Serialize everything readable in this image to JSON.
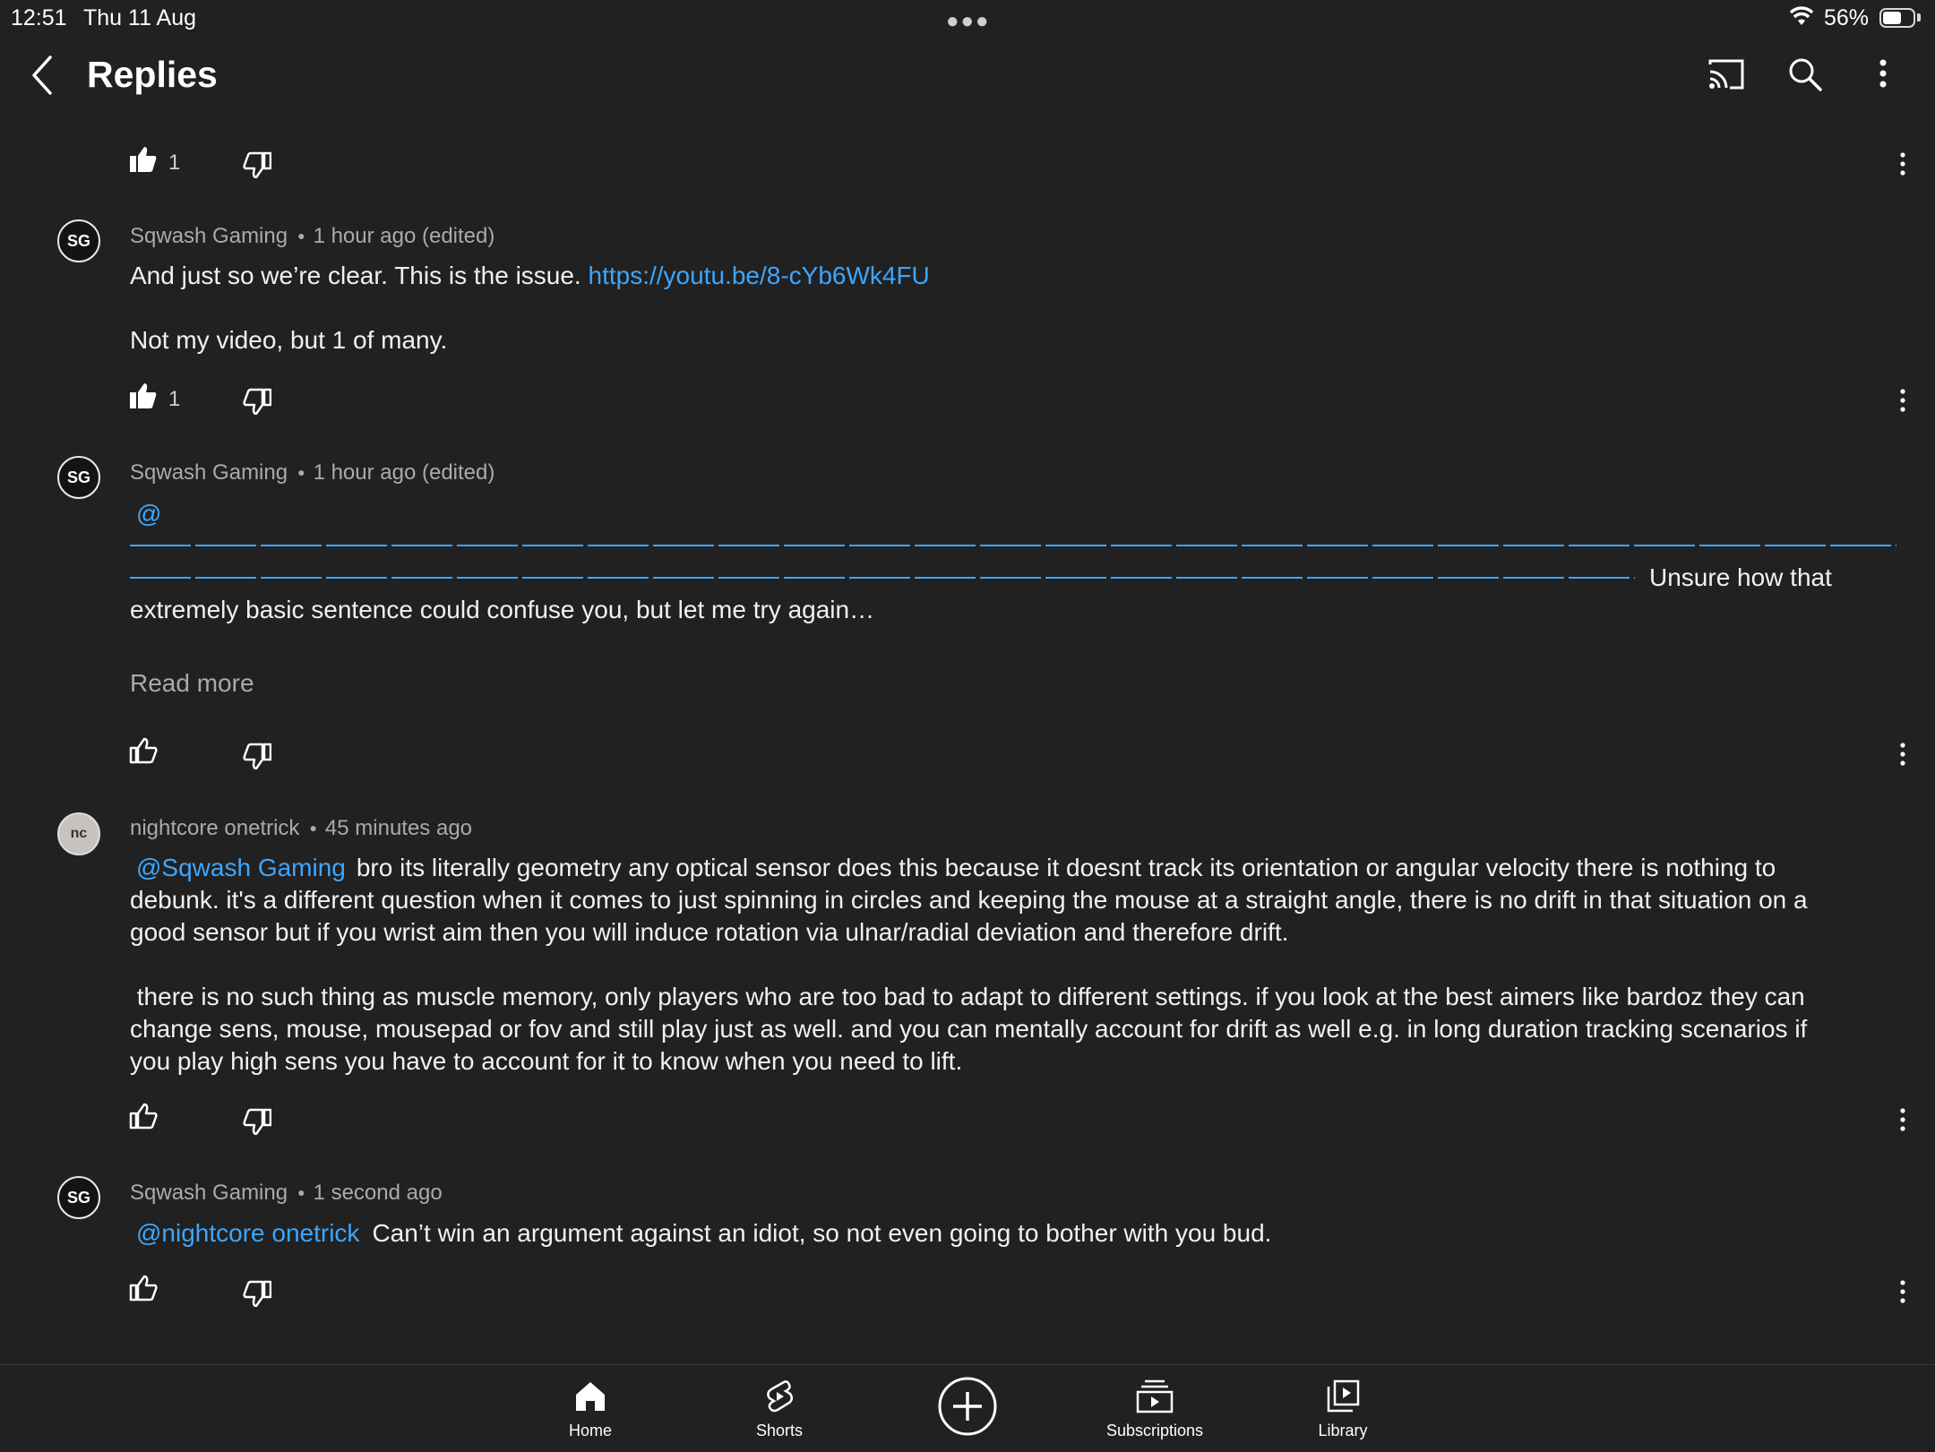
{
  "status_bar": {
    "time": "12:51",
    "date": "Thu 11 Aug",
    "battery": "56%"
  },
  "header": {
    "title": "Replies"
  },
  "top_partial": {
    "likes": "1"
  },
  "comments": [
    {
      "author": "Sqwash Gaming",
      "time": "1 hour ago (edited)",
      "text_before_link": "And just so we’re clear. This is the issue. ",
      "link": "https://youtu.be/8-cYb6Wk4FU",
      "text_after": "Not my video, but 1 of many.",
      "likes": "1"
    },
    {
      "author": "Sqwash Gaming",
      "time": "1 hour ago (edited)",
      "mention": "@",
      "text_inline": "Unsure how that",
      "text_next": "extremely basic sentence could confuse you, but let me try again…",
      "read_more": "Read more"
    },
    {
      "author": "nightcore onetrick",
      "time": "45 minutes ago",
      "mention": "@Sqwash Gaming",
      "para1_line1": "bro its literally geometry any optical sensor does this because it doesnt track its orientation or angular velocity there is nothing to",
      "para1_line2": "debunk. it's a different question when it comes to just spinning in circles and keeping the mouse at a straight angle, there is no drift in that situation on a",
      "para1_line3": "good sensor but if you wrist aim then you will induce rotation via ulnar/radial deviation and therefore drift.",
      "para2_line1": " there is no such thing as muscle memory, only players who are too bad to adapt to different settings. if you look at the best aimers like bardoz they can",
      "para2_line2": "change sens, mouse, mousepad or fov and still play just as well. and you can mentally account for drift as well e.g. in long duration tracking scenarios if",
      "para2_line3": "you play high sens you have to account for it to know when you need to lift."
    },
    {
      "author": "Sqwash Gaming",
      "time": "1 second ago",
      "mention": "@nightcore onetrick",
      "text": "Can’t win an argument against an idiot, so not even going to bother with you bud."
    }
  ],
  "nav": {
    "home": "Home",
    "shorts": "Shorts",
    "subscriptions": "Subscriptions",
    "library": "Library"
  },
  "colors": {
    "background": "#212121",
    "link": "#3ea6ff",
    "meta": "#aaaaaa"
  }
}
